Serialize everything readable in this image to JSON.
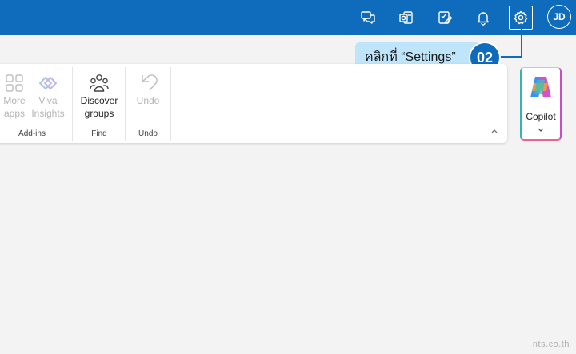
{
  "header": {
    "icons": [
      "feedback-chat-icon",
      "teams-outlook-icon",
      "checklist-pen-icon",
      "bell-icon",
      "gear-icon"
    ],
    "avatar_initials": "JD",
    "brand_color": "#0f6cbd"
  },
  "callout": {
    "text": "คลิกที่ “Settings”",
    "step": "02",
    "bg_color": "#bfe5fb"
  },
  "ribbon": {
    "addins": {
      "more_apps": [
        "More",
        "apps"
      ],
      "viva_insights": [
        "Viva",
        "Insights"
      ],
      "group_label": "Add-ins"
    },
    "find": {
      "discover_groups": [
        "Discover",
        "groups"
      ],
      "group_label": "Find"
    },
    "undo": {
      "label": "Undo",
      "group_label": "Undo"
    }
  },
  "copilot": {
    "label": "Copilot"
  },
  "watermark": "nts.co.th"
}
